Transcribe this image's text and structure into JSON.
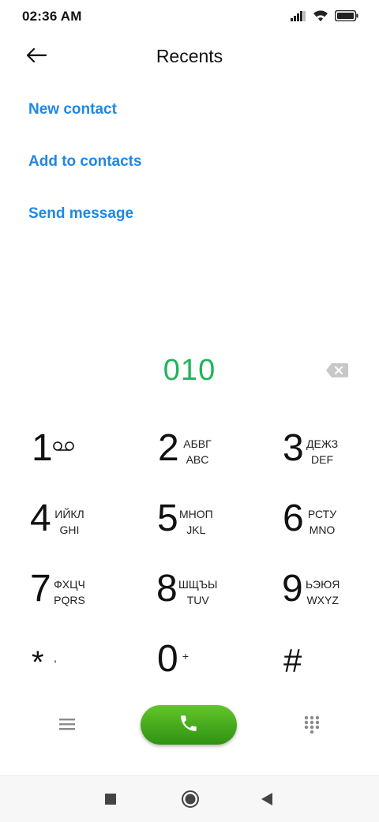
{
  "status_bar": {
    "time": "02:36 AM",
    "icons": [
      "signal-icon",
      "wifi-icon",
      "battery-icon"
    ]
  },
  "header": {
    "title": "Recents",
    "back_icon": "arrow-left-icon"
  },
  "actions": [
    {
      "label": "New contact"
    },
    {
      "label": "Add to contacts"
    },
    {
      "label": "Send message"
    }
  ],
  "dialer": {
    "number": "010",
    "number_color": "#21b45a",
    "backspace_icon": "backspace-icon"
  },
  "keypad": {
    "keys": [
      {
        "digit": "1",
        "line1": "",
        "line2": "",
        "icon": "voicemail-icon"
      },
      {
        "digit": "2",
        "line1": "АБВГ",
        "line2": "ABC"
      },
      {
        "digit": "3",
        "line1": "ДЕЖЗ",
        "line2": "DEF"
      },
      {
        "digit": "4",
        "line1": "ИЙКЛ",
        "line2": "GHI"
      },
      {
        "digit": "5",
        "line1": "МНОП",
        "line2": "JKL"
      },
      {
        "digit": "6",
        "line1": "РСТУ",
        "line2": "MNO"
      },
      {
        "digit": "7",
        "line1": "ФХЦЧ",
        "line2": "PQRS"
      },
      {
        "digit": "8",
        "line1": "ШЩЪЫ",
        "line2": "TUV"
      },
      {
        "digit": "9",
        "line1": "ЬЭЮЯ",
        "line2": "WXYZ"
      },
      {
        "digit": "*",
        "line1": ",",
        "line2": ""
      },
      {
        "digit": "0",
        "line1": "+",
        "line2": ""
      },
      {
        "digit": "#",
        "line1": "",
        "line2": ""
      }
    ]
  },
  "bottom_row": {
    "menu_icon": "menu-icon",
    "call_icon": "phone-icon",
    "call_color": "#3fa81b",
    "dialpad_icon": "dialpad-icon"
  },
  "nav_bar": {
    "icons": [
      "recent-apps-icon",
      "home-icon",
      "back-icon"
    ]
  }
}
